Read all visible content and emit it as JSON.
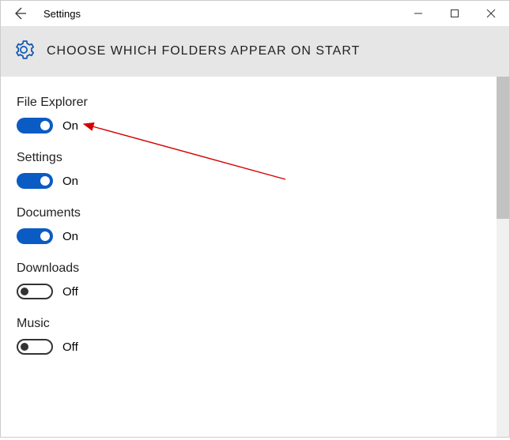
{
  "window": {
    "title": "Settings"
  },
  "header": {
    "title": "CHOOSE WHICH FOLDERS APPEAR ON START"
  },
  "toggles": {
    "on_label": "On",
    "off_label": "Off"
  },
  "items": [
    {
      "label": "File Explorer",
      "state": "on"
    },
    {
      "label": "Settings",
      "state": "on"
    },
    {
      "label": "Documents",
      "state": "on"
    },
    {
      "label": "Downloads",
      "state": "off"
    },
    {
      "label": "Music",
      "state": "off"
    }
  ]
}
